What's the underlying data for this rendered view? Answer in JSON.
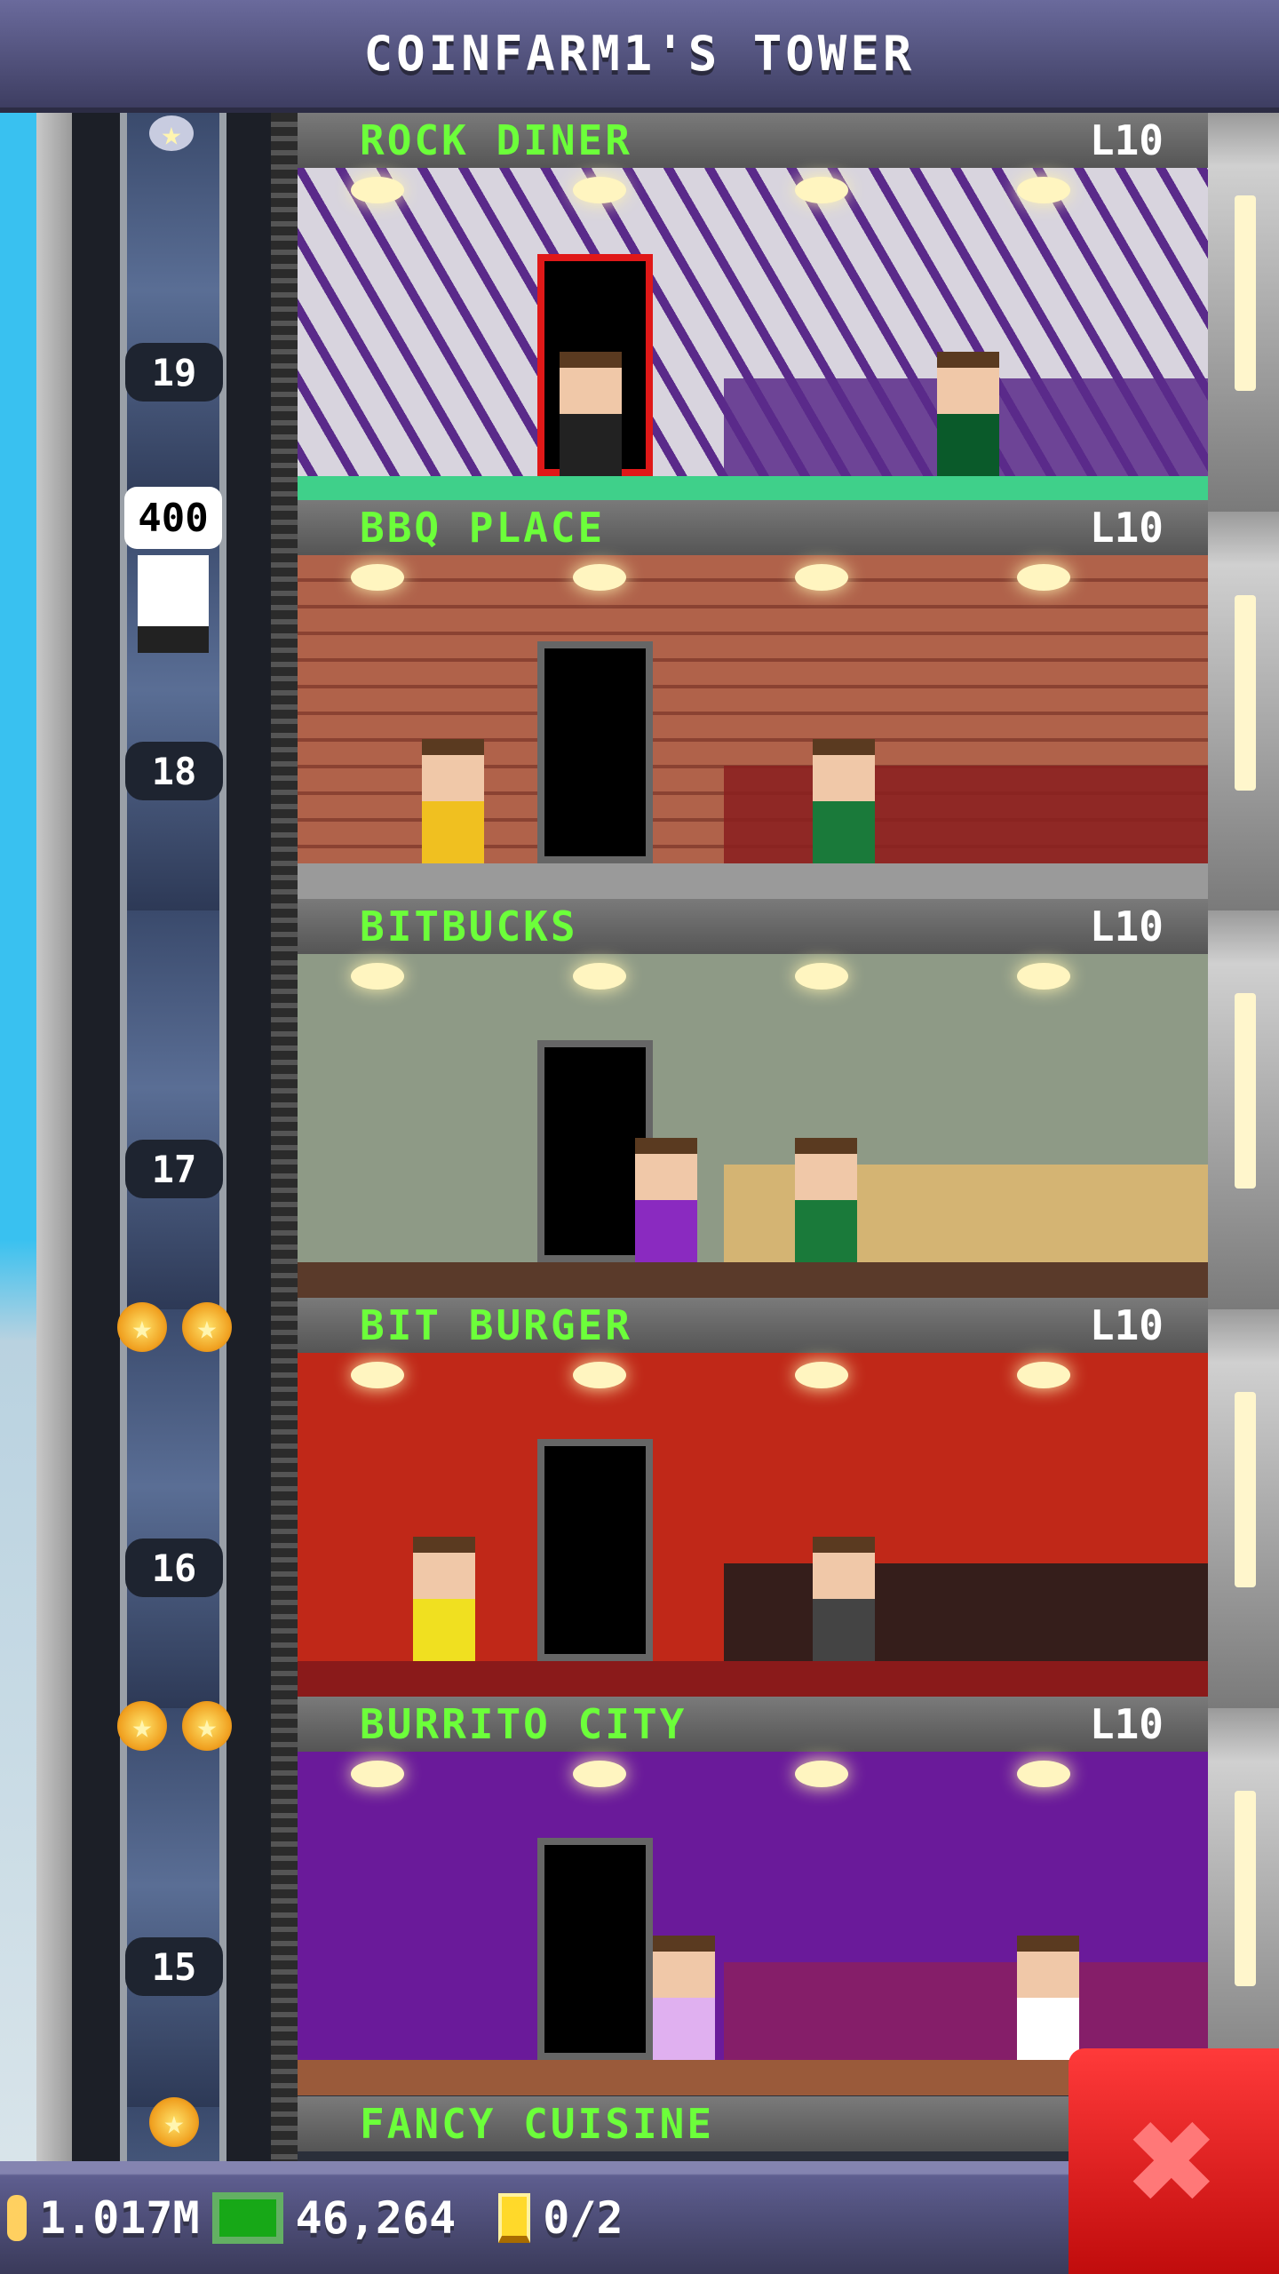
{
  "header": {
    "title": "COINFARM1'S TOWER"
  },
  "elevator": {
    "floor_numbers": [
      "19",
      "18",
      "17",
      "16",
      "15"
    ],
    "bubble_value": "400"
  },
  "floors": [
    {
      "name": "ROCK DINER",
      "level": "L10",
      "wall": "#d8d4de",
      "accent": "#5a2a8a",
      "ground": "#3fd08a"
    },
    {
      "name": "BBQ PLACE",
      "level": "L10",
      "wall": "#b0624a",
      "accent": "#8a1e1e",
      "ground": "#9a9a9a"
    },
    {
      "name": "BITBUCKS",
      "level": "L10",
      "wall": "#8e9a86",
      "accent": "#e0b870",
      "ground": "#5a3a2a"
    },
    {
      "name": "BIT BURGER",
      "level": "L10",
      "wall": "#c02818",
      "accent": "#1c1c1c",
      "ground": "#8a1a1a"
    },
    {
      "name": "BURRITO CITY",
      "level": "L10",
      "wall": "#6a1a9a",
      "accent": "#8a2060",
      "ground": "#9a5a3a"
    },
    {
      "name": "FANCY CUISINE",
      "level": "",
      "wall": "#a8a8a8",
      "accent": "#888",
      "ground": "#a8a8a8"
    }
  ],
  "bottom_bar": {
    "coins": "1.017M",
    "bux": "46,264",
    "tickets": "0/2"
  },
  "colors": {
    "label_green": "#6cff3a",
    "close_red": "#e81c1c"
  }
}
